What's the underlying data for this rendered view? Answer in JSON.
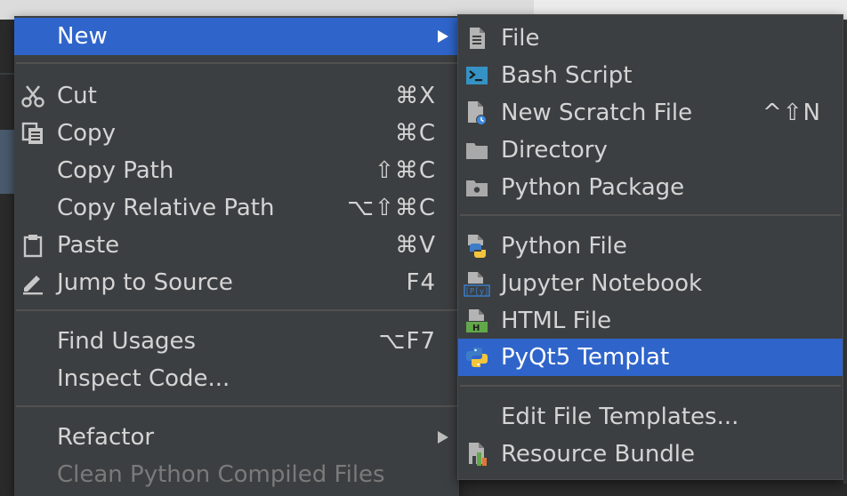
{
  "main_menu": {
    "items": [
      {
        "label": "New",
        "shortcut": "",
        "icon": "none",
        "submenu": true,
        "selected": true
      },
      {
        "label": "Cut",
        "shortcut": "⌘X",
        "icon": "scissors-icon"
      },
      {
        "label": "Copy",
        "shortcut": "⌘C",
        "icon": "copy-icon"
      },
      {
        "label": "Copy Path",
        "shortcut": "⇧⌘C",
        "icon": "none"
      },
      {
        "label": "Copy Relative Path",
        "shortcut": "⌥⇧⌘C",
        "icon": "none"
      },
      {
        "label": "Paste",
        "shortcut": "⌘V",
        "icon": "clipboard-icon"
      },
      {
        "label": "Jump to Source",
        "shortcut": "F4",
        "icon": "pencil-icon"
      },
      {
        "label": "Find Usages",
        "shortcut": "⌥F7",
        "icon": "none"
      },
      {
        "label": "Inspect Code...",
        "shortcut": "",
        "icon": "none"
      },
      {
        "label": "Refactor",
        "shortcut": "",
        "icon": "none",
        "submenu": true
      },
      {
        "label": "Clean Python Compiled Files",
        "shortcut": "",
        "icon": "none",
        "disabled": true
      }
    ]
  },
  "sub_menu": {
    "items": [
      {
        "label": "File",
        "shortcut": "",
        "icon": "file-icon"
      },
      {
        "label": "Bash Script",
        "shortcut": "",
        "icon": "terminal-icon"
      },
      {
        "label": "New Scratch File",
        "shortcut": "^⇧N",
        "icon": "scratch-file-icon"
      },
      {
        "label": "Directory",
        "shortcut": "",
        "icon": "folder-icon"
      },
      {
        "label": "Python Package",
        "shortcut": "",
        "icon": "package-folder-icon"
      },
      {
        "label": "Python File",
        "shortcut": "",
        "icon": "python-file-icon"
      },
      {
        "label": "Jupyter Notebook",
        "shortcut": "",
        "icon": "jupyter-file-icon"
      },
      {
        "label": "HTML File",
        "shortcut": "",
        "icon": "html-file-icon"
      },
      {
        "label": "PyQt5 Templat",
        "shortcut": "",
        "icon": "python-logo-icon",
        "selected": true
      },
      {
        "label": "Edit File Templates...",
        "shortcut": "",
        "icon": "none"
      },
      {
        "label": "Resource Bundle",
        "shortcut": "",
        "icon": "resource-bundle-icon"
      }
    ]
  },
  "colors": {
    "menu_bg": "#3c3f41",
    "selection": "#2f65ca",
    "text": "#d4d4d4",
    "disabled_text": "#7a7a7a",
    "separator": "#515151"
  }
}
